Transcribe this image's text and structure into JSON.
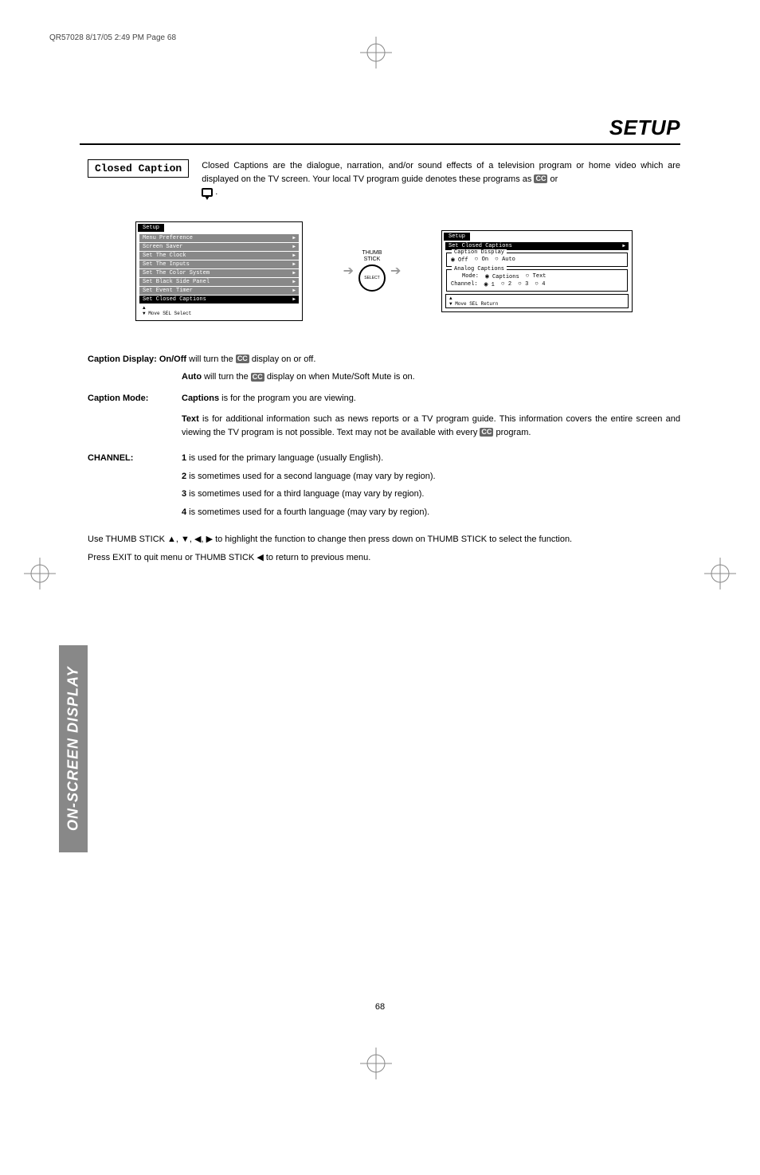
{
  "header_line": "QR57028  8/17/05  2:49 PM  Page 68",
  "section_title": "SETUP",
  "sidebar_label": "ON-SCREEN DISPLAY",
  "page_number": "68",
  "closed_caption": {
    "box_label": "Closed Caption",
    "intro_a": "Closed Captions are the dialogue, narration, and/or sound effects of a television program or home video which are displayed on the TV screen.  Your local TV program guide denotes these programs as ",
    "intro_or": " or ",
    "intro_period": "."
  },
  "menu_left": {
    "title": "Setup",
    "items": [
      "Menu Preference",
      "Screen Saver",
      "Set The Clock",
      "Set The Inputs",
      "Set The Color System",
      "Set Black Side Panel",
      "Set Event Timer",
      "Set Closed Captions"
    ],
    "footer": "  Move  SEL  Select"
  },
  "thumb": {
    "label_a": "THUMB",
    "label_b": "STICK",
    "inner": "SELECT"
  },
  "menu_right": {
    "title": "Setup",
    "subtitle": "Set Closed Captions",
    "group1_label": "Caption Display",
    "group1_opts": [
      "Off",
      "On",
      "Auto"
    ],
    "group2_label": "Analog Captions",
    "mode_label": "Mode:",
    "mode_opts": [
      "Captions",
      "Text"
    ],
    "channel_label": "Channel:",
    "channel_opts": [
      "1",
      "2",
      "3",
      "4"
    ],
    "nav": "  Move  SEL  Return"
  },
  "body": {
    "caption_display_prefix": "Caption Display: On/Off",
    "caption_display_rest": " will turn the ",
    "caption_display_tail": " display on or off.",
    "auto_bold": "Auto",
    "auto_rest": " will turn the ",
    "auto_tail": " display on when Mute/Soft Mute is on.",
    "caption_mode_label": "Caption Mode:",
    "captions_bold": "Captions",
    "captions_rest": " is for the program you are viewing.",
    "text_bold": "Text",
    "text_rest_a": " is for additional information such as news reports or a TV program guide.  This information covers the entire screen and viewing the TV program is not possible.  Text may not be available with every ",
    "text_rest_b": " program.",
    "channel_label": "CHANNEL:",
    "ch1_a": "1",
    "ch1_b": " is used for the primary language (usually English).",
    "ch2_a": "2",
    "ch2_b": " is sometimes used for a second language (may vary by region).",
    "ch3_a": "3",
    "ch3_b": " is sometimes used for a third language (may vary by region).",
    "ch4_a": "4",
    "ch4_b": " is sometimes used for a fourth language (may vary by region).",
    "footer1": "Use THUMB STICK ▲, ▼, ◀, ▶ to highlight the function to change then press down on THUMB STICK to select the function.",
    "footer2": "Press EXIT to quit menu or THUMB STICK ◀ to return to previous menu."
  }
}
